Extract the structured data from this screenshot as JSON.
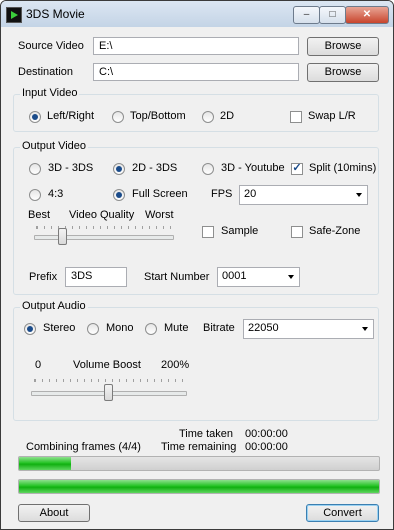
{
  "window": {
    "title": "3DS Movie"
  },
  "files": {
    "source_label": "Source Video",
    "source_value": "E:\\",
    "destination_label": "Destination",
    "destination_value": "C:\\",
    "browse_label": "Browse"
  },
  "input_video": {
    "title": "Input Video",
    "options": [
      "Left/Right",
      "Top/Bottom",
      "2D"
    ],
    "selected": "Left/Right",
    "swap_label": "Swap L/R",
    "swap_checked": false
  },
  "output_video": {
    "title": "Output Video",
    "modes": [
      "3D - 3DS",
      "2D - 3DS",
      "3D - Youtube"
    ],
    "mode_selected": "2D - 3DS",
    "split_label": "Split (10mins)",
    "split_checked": true,
    "aspects": [
      "4:3",
      "Full Screen"
    ],
    "aspect_selected": "Full Screen",
    "fps_label": "FPS",
    "fps_value": "20",
    "quality_best": "Best",
    "quality_label": "Video Quality",
    "quality_worst": "Worst",
    "quality_level": 0.2,
    "sample_label": "Sample",
    "sample_checked": false,
    "safezone_label": "Safe-Zone",
    "safezone_checked": false,
    "prefix_label": "Prefix",
    "prefix_value": "3DS",
    "start_number_label": "Start Number",
    "start_number_value": "0001"
  },
  "output_audio": {
    "title": "Output Audio",
    "modes": [
      "Stereo",
      "Mono",
      "Mute"
    ],
    "mode_selected": "Stereo",
    "bitrate_label": "Bitrate",
    "bitrate_value": "22050",
    "boost_min": "0",
    "boost_label": "Volume Boost",
    "boost_max": "200%",
    "boost_level": 0.5
  },
  "status": {
    "time_taken_label": "Time taken",
    "time_taken_value": "00:00:00",
    "time_remaining_label": "Time remaining",
    "time_remaining_value": "00:00:00",
    "combining_label": "Combining frames (4/4)",
    "progress_current": 0.145,
    "progress_total": 1.0
  },
  "footer": {
    "about_label": "About",
    "convert_label": "Convert"
  },
  "colors": {
    "progress_green": "#10b010",
    "selected_radio": "#1a4b8a"
  }
}
